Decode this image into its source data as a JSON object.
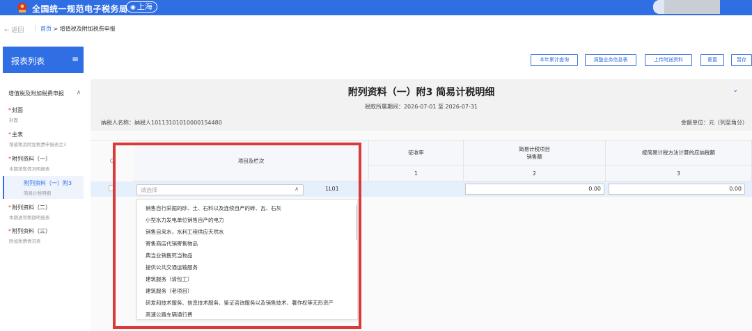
{
  "header": {
    "app_title": "全国统一规范电子税务局",
    "region": "上海",
    "colors": {
      "brand": "#2f6ee3",
      "highlight": "#d93b3b"
    }
  },
  "breadcrumb": {
    "back_label": "返回",
    "home": "首页",
    "separator": ">",
    "current": "增值税及附加税费申报"
  },
  "sidebar": {
    "title": "报表列表",
    "group_label": "增值税及附加税费申报",
    "items": [
      {
        "label": "封面",
        "sub": "封面"
      },
      {
        "label": "主表",
        "sub": "增值税及附加税费申报表主3"
      },
      {
        "label": "附列资料（一）",
        "sub": "本期销售情况明细表"
      },
      {
        "label": "附列资料（一）附3",
        "sub": "简易计税明细"
      },
      {
        "label": "附列资料（二）",
        "sub": "本期进项税额明细表"
      },
      {
        "label": "附列资料（三）",
        "sub": "附加税费情况表"
      }
    ]
  },
  "toolbar": {
    "buttons": [
      "本年累计查询",
      "调整业务信息表",
      "上传附送资料",
      "重置",
      "暂存"
    ]
  },
  "form": {
    "title": "附列资料（一）附3 简易计税明细",
    "period": "税款所属期间：2026-07-01 至 2026-07-31",
    "taxpayer": "纳税人名称：纳税人10113101010000154480",
    "unit": "金额单位：元（列至角分）"
  },
  "table": {
    "headers": {
      "item_column": "项目及栏次",
      "rate": "征收率",
      "sales_line1": "简易计税项目",
      "sales_line2": "销售额",
      "tax": "按简易计税方法计算的应纳税额"
    },
    "column_numbers": [
      "1",
      "2",
      "3"
    ],
    "row": {
      "code": "1L01",
      "sales_value": "0.00",
      "tax_value": "0.00"
    }
  },
  "select": {
    "placeholder": "请选择",
    "options": [
      "销售自行采掘的砂、土、石料以及连续自产的砖、瓦、石灰",
      "小型水力发电单位销售自产的电力",
      "销售自来水，水利工程供应天然水",
      "寄售商店代销寄售物品",
      "典当业销售死当物品",
      "提供公共交通运输服务",
      "建筑服务（清包工）",
      "建筑服务（老项目）",
      "研发和技术服务、信息技术服务、鉴证咨询服务以及销售技术、著作权等无形资产",
      "高速公路车辆通行费"
    ]
  }
}
